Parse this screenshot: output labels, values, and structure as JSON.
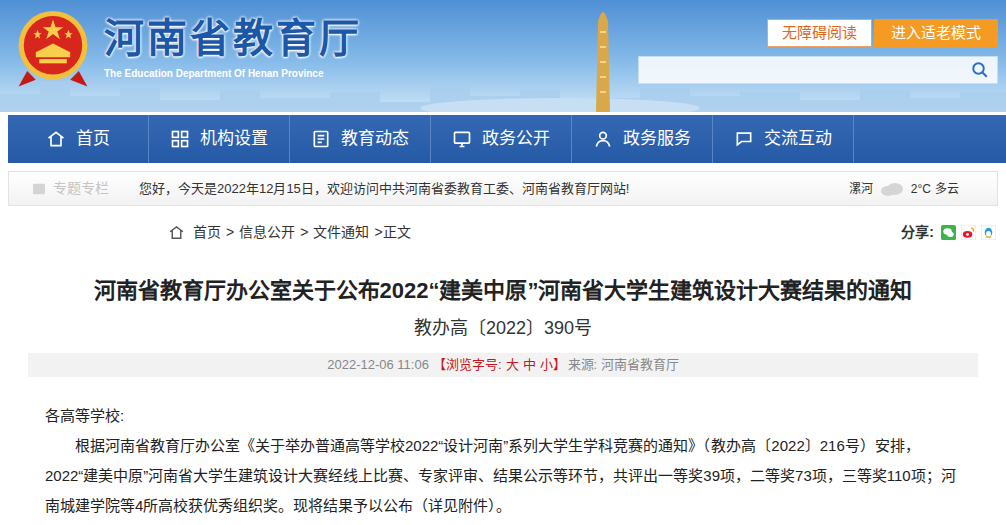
{
  "header": {
    "title": "河南省教育厅",
    "subtitle": "The Education Department Of Henan Province",
    "buttons": [
      {
        "label": "无障碍阅读",
        "kind": "outline"
      },
      {
        "label": "进入适老模式",
        "kind": "filled"
      }
    ]
  },
  "nav": {
    "items": [
      {
        "label": "首页",
        "selected": false
      },
      {
        "label": "机构设置",
        "selected": false
      },
      {
        "label": "教育动态",
        "selected": false
      },
      {
        "label": "政务公开",
        "selected": false
      },
      {
        "label": "政务服务",
        "selected": false
      },
      {
        "label": "交流互动",
        "selected": false
      }
    ]
  },
  "info_bar": {
    "topic": "专题专栏",
    "greeting": "您好，今天是2022年12月15日，欢迎访问中共河南省委教育工委、河南省教育厅网站!",
    "city": "漯河",
    "temperature": "2°C",
    "weather": "多云"
  },
  "breadcrumb": {
    "items": [
      "首页",
      "信息公开",
      "文件通知",
      "正文"
    ],
    "separator": ">"
  },
  "share": {
    "label": "分享:"
  },
  "article": {
    "title": "河南省教育厅办公室关于公布2022“建美中原”河南省大学生建筑设计大赛结果的通知",
    "doc_number": "教办高〔2022〕390号",
    "date": "2022-12-06 11:06",
    "font_size": {
      "prefix": "【浏览字号:",
      "options": [
        "大",
        "中",
        "小"
      ],
      "suffix": "】"
    },
    "source": "来源: 河南省教育厅",
    "salutation": "各高等学校:",
    "paragraphs": [
      "根据河南省教育厅办公室《关于举办普通高等学校2022“设计河南”系列大学生学科竞赛的通知》（教办高〔2022〕216号）安排，2022“建美中原”河南省大学生建筑设计大赛经线上比赛、专家评审、结果公示等环节，共评出一等奖39项，二等奖73项，三等奖110项；河南城建学院等4所高校获优秀组织奖。现将结果予以公布（详见附件）。"
    ]
  }
}
